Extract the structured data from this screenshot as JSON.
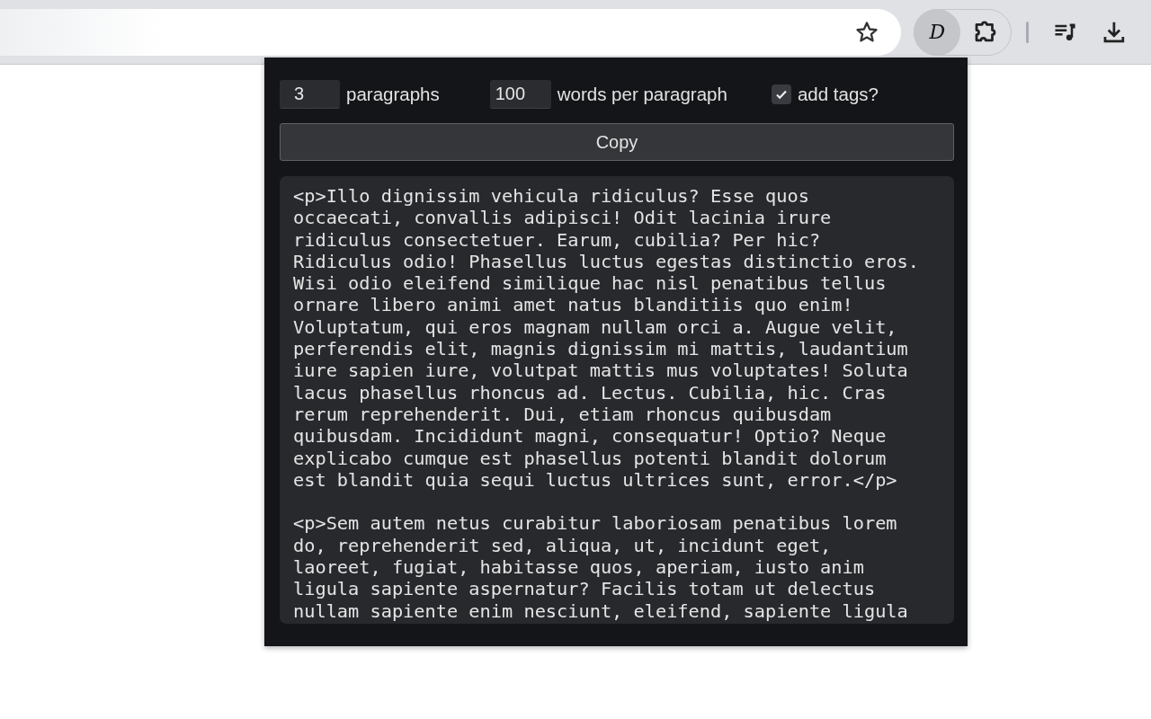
{
  "toolbar": {
    "extension_badge": "D",
    "extension_active": true
  },
  "popup": {
    "paragraphs_field": {
      "value": "3",
      "label": "paragraphs"
    },
    "words_field": {
      "value": "100",
      "label": "words per paragraph"
    },
    "add_tags": {
      "label": "add tags?",
      "checked": true
    },
    "copy_button": "Copy",
    "output": [
      {
        "lines": [
          "<p>Illo dignissim vehicula ridiculus? Esse quos",
          "occaecati, convallis adipisci! Odit lacinia irure",
          "ridiculus consectetuer. Earum, cubilia? Per hic?",
          "Ridiculus odio! Phasellus luctus egestas distinctio eros.",
          "Wisi odio eleifend similique hac nisl penatibus tellus",
          "ornare libero animi amet natus blanditiis quo enim!",
          "Voluptatum, qui eros magnam nullam orci a. Augue velit,",
          "perferendis elit, magnis dignissim mi mattis, laudantium",
          "iure sapien iure, volutpat mattis mus voluptates! Soluta",
          "lacus phasellus rhoncus ad. Lectus. Cubilia, hic. Cras",
          "rerum reprehenderit. Dui, etiam rhoncus quibusdam",
          "quibusdam. Incididunt magni, consequatur! Optio? Neque",
          "explicabo cumque est phasellus potenti blandit dolorum",
          "est blandit quia sequi luctus ultrices sunt, error.</p>"
        ]
      },
      {
        "lines": [
          "<p>Sem autem netus curabitur laboriosam penatibus lorem",
          "do, reprehenderit sed, aliqua, ut, incidunt eget,",
          "laoreet, fugiat, habitasse quos, aperiam, iusto anim",
          "ligula sapiente aspernatur? Facilis totam ut delectus",
          "nullam sapiente enim nesciunt, eleifend, sapiente ligula"
        ]
      }
    ]
  }
}
